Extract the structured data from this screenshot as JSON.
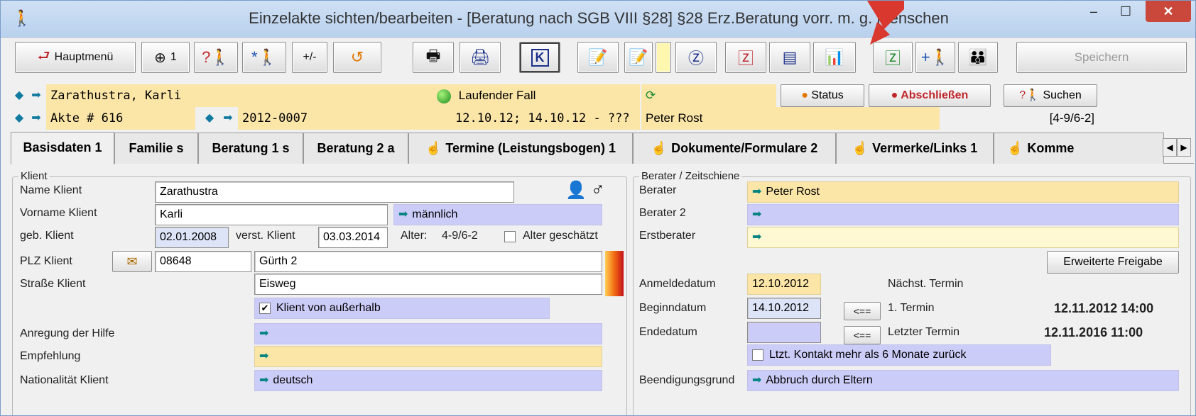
{
  "window": {
    "title": "Einzelakte sichten/bearbeiten -  [Beratung nach SGB VIII §28] §28 Erz.Beratung vorr. m.    g. Menschen",
    "minimize": "–",
    "maximize": "☐",
    "close": "✕"
  },
  "toolbar": {
    "hauptmenu": "Hauptmenü",
    "target_count": "1",
    "plusminus": "+/-",
    "save": "Speichern"
  },
  "case": {
    "client_name": "Zarathustra, Karli",
    "akte": "Akte # 616",
    "case_number": "2012-0007",
    "status_text": "Laufender Fall",
    "dates": "12.10.12; 14.10.12 - ???",
    "berater": "Peter Rost",
    "status_button": "Status",
    "close_button": "Abschließen",
    "search_button": "Suchen",
    "age_code": "[4-9/6-2]"
  },
  "tabs": [
    {
      "label": "Basisdaten 1"
    },
    {
      "label": "Familie s"
    },
    {
      "label": "Beratung 1 s"
    },
    {
      "label": "Beratung 2 a"
    },
    {
      "label": "Termine (Leistungsbogen) 1"
    },
    {
      "label": "Dokumente/Formulare 2"
    },
    {
      "label": "Vermerke/Links 1"
    },
    {
      "label": "Komme"
    }
  ],
  "klient": {
    "group_label": "Klient",
    "name_label": "Name Klient",
    "name_value": "Zarathustra",
    "vorname_label": "Vorname Klient",
    "vorname_value": "Karli",
    "gender": "männlich",
    "geb_label": "geb. Klient",
    "geb_value": "02.01.2008",
    "verst_label": "verst. Klient",
    "verst_value": "03.03.2014",
    "alter_label": "Alter:",
    "alter_value": "4-9/6-2",
    "alter_geschaetzt": "Alter geschätzt",
    "plz_label": "PLZ Klient",
    "plz_value": "08648",
    "ort_value": "Gürth 2",
    "strasse_label": "Straße Klient",
    "strasse_value": "Eisweg",
    "ausserhalb": "Klient von außerhalb",
    "anregung_label": "Anregung der Hilfe",
    "empfehlung_label": "Empfehlung",
    "nationalitaet_label": "Nationalität Klient",
    "nationalitaet_value": "deutsch"
  },
  "berater_panel": {
    "group_label": "Berater / Zeitschiene",
    "berater_label": "Berater",
    "berater_value": "Peter Rost",
    "berater2_label": "Berater 2",
    "erstberater_label": "Erstberater",
    "freigabe_button": "Erweiterte Freigabe",
    "anmelde_label": "Anmeldedatum",
    "anmelde_value": "12.10.2012",
    "naechst_label": "Nächst. Termin",
    "beginn_label": "Beginndatum",
    "beginn_value": "14.10.2012",
    "arrow_button": "<==",
    "erster_label": "1. Termin",
    "erster_value": "12.11.2012 14:00",
    "ende_label": "Endedatum",
    "letzter_label": "Letzter Termin",
    "letzter_value": "12.11.2016 11:00",
    "kontakt_label": "Ltzt. Kontakt mehr als 6 Monate zurück",
    "beendigung_label": "Beendigungsgrund",
    "beendigung_value": "Abbruch durch Eltern"
  }
}
